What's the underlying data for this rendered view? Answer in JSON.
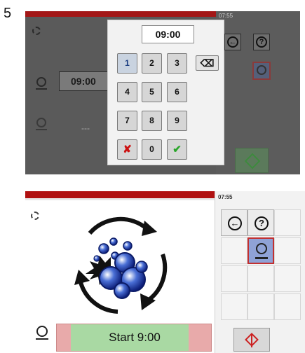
{
  "step": "5",
  "top_screen": {
    "clock": "07:55",
    "time_field": "09:00",
    "empty_field": "---",
    "keypad": {
      "display": "09:00",
      "keys": [
        "1",
        "2",
        "3",
        "4",
        "5",
        "6",
        "7",
        "8",
        "9",
        "0"
      ],
      "backspace": "⌫",
      "cancel": "✘",
      "confirm": "✔"
    }
  },
  "bottom_screen": {
    "clock": "07:55",
    "start_label": "Start 9:00"
  },
  "icons": {
    "back": "back-arrow-icon",
    "help": "help-icon",
    "timer": "timer-icon",
    "start": "start-diamond-icon",
    "wash": "wash-cycle-icon"
  },
  "colors": {
    "status_bar": "#b01010",
    "start_field_bg": "#e8aaaa",
    "start_progress": "#a9d9a3",
    "timer_button": "#8fa2d6"
  }
}
